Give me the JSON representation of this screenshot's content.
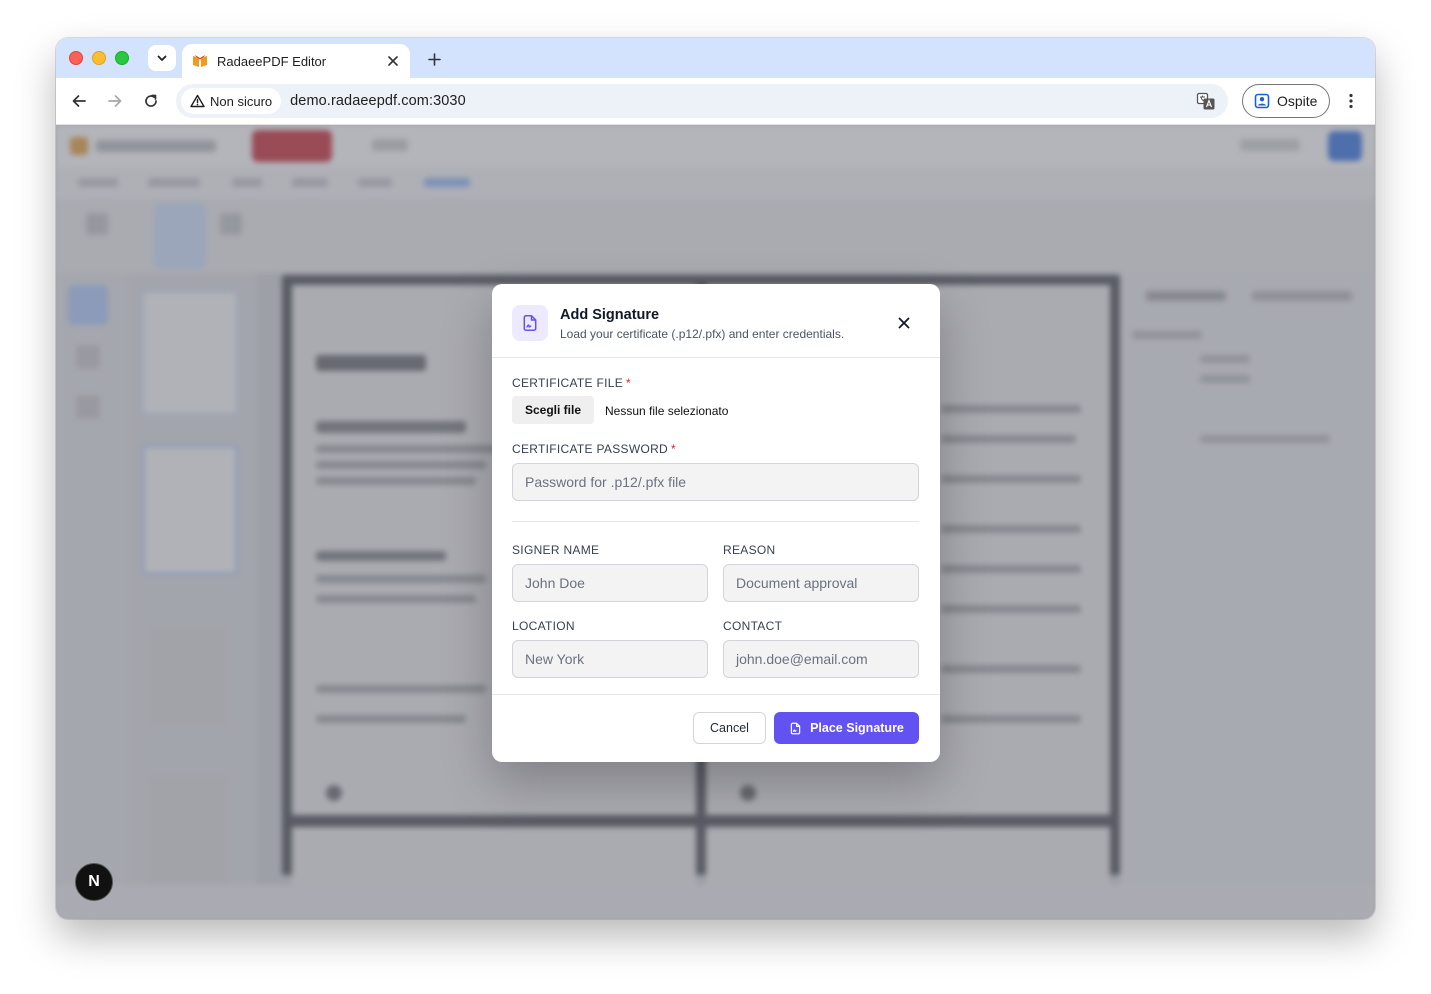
{
  "browser": {
    "tab_title": "RadaeePDF Editor",
    "security_label": "Non sicuro",
    "url": "demo.radaeepdf.com:3030",
    "profile_label": "Ospite"
  },
  "dialog": {
    "title": "Add Signature",
    "subtitle": "Load your certificate (.p12/.pfx) and enter credentials.",
    "certificate_file_label": "CERTIFICATE FILE",
    "file_button_label": "Scegli file",
    "file_status": "Nessun file selezionato",
    "certificate_password_label": "CERTIFICATE PASSWORD",
    "required_marker": "*",
    "password_placeholder": "Password for .p12/.pfx file",
    "signer_name_label": "SIGNER NAME",
    "signer_name_placeholder": "John Doe",
    "reason_label": "REASON",
    "reason_placeholder": "Document approval",
    "location_label": "LOCATION",
    "location_placeholder": "New York",
    "contact_label": "CONTACT",
    "contact_placeholder": "john.doe@email.com",
    "cancel_label": "Cancel",
    "place_label": "Place Signature"
  },
  "badge": {
    "letter": "N"
  },
  "colors": {
    "accent": "#6352f2",
    "accent_light": "#ede9fe",
    "required": "#dc2626",
    "tab_strip": "#d3e3fd"
  },
  "icons": {
    "tab_search": "chevron-down-icon",
    "favicon": "radaee-logo-icon",
    "tab_close": "close-icon",
    "new_tab": "plus-icon",
    "back": "arrow-left-icon",
    "forward": "arrow-right-icon",
    "reload": "reload-icon",
    "security": "warning-triangle-icon",
    "translate": "translate-icon",
    "profile": "guest-profile-icon",
    "menu": "more-vertical-icon",
    "dialog": "file-signature-icon",
    "dialog_close": "close-icon"
  }
}
